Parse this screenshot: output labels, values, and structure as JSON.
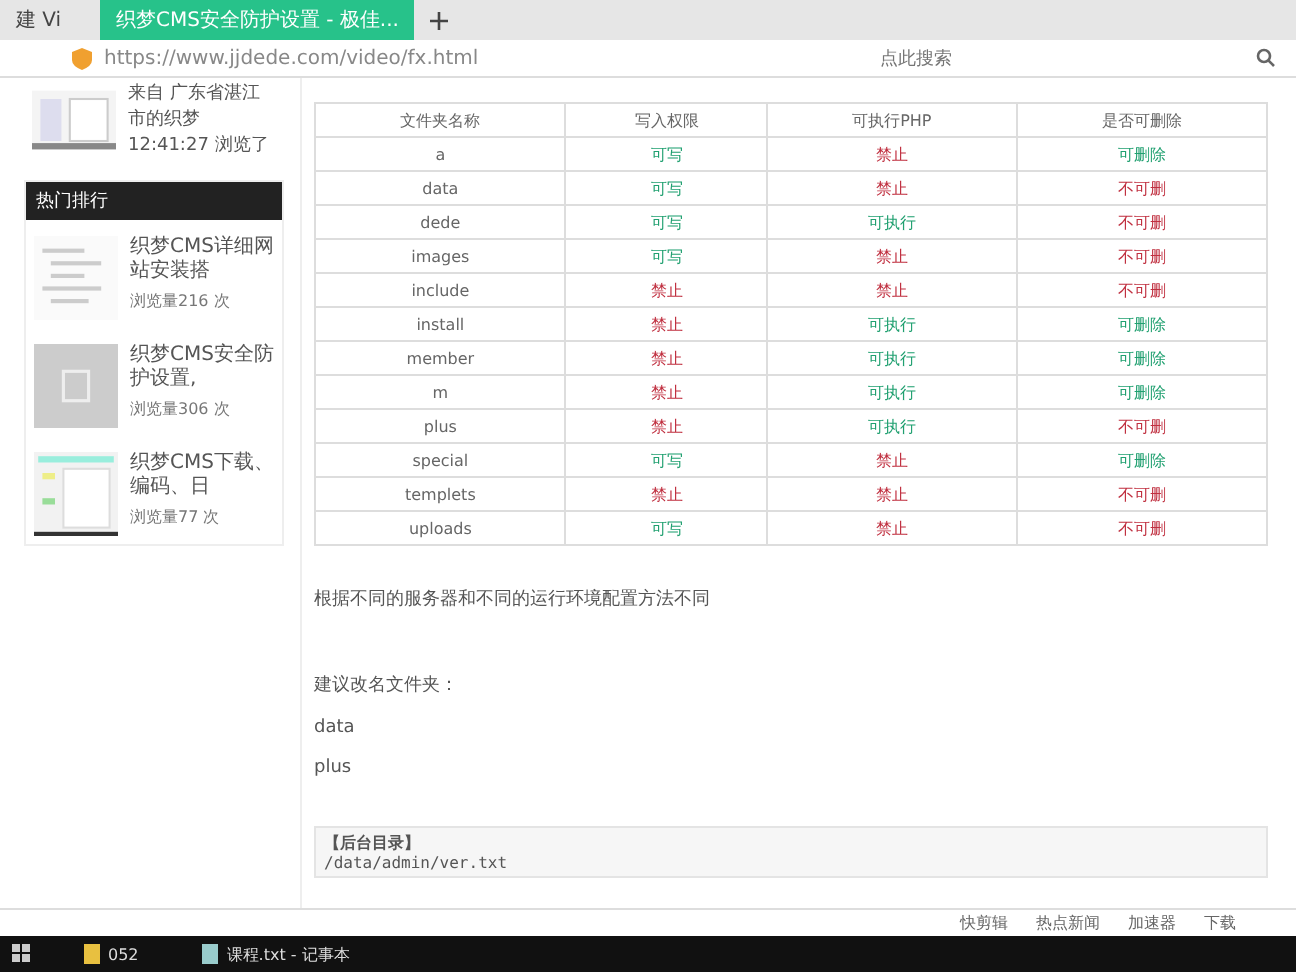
{
  "tabs": [
    {
      "label": "建 Vi",
      "selected": false
    },
    {
      "label": "织梦CMS安全防护设置 - 极佳...",
      "selected": true
    }
  ],
  "address": {
    "url": "https://www.jjdede.com/video/fx.html",
    "search_placeholder": "点此搜索"
  },
  "sidebar": {
    "visit_note": "来自 广东省湛江市的织梦 12:41:27 浏览了",
    "heading": "热门排行",
    "items": [
      {
        "title": "织梦CMS详细网站安装搭",
        "views": "浏览量216 次"
      },
      {
        "title": "织梦CMS安全防护设置,",
        "views": "浏览量306 次"
      },
      {
        "title": "织梦CMS下载、编码、日",
        "views": "浏览量77 次"
      }
    ]
  },
  "table": {
    "columns": [
      "文件夹名称",
      "写入权限",
      "可执行PHP",
      "是否可删除"
    ],
    "rows": [
      [
        {
          "text": "a"
        },
        {
          "text": "可写",
          "ok": true
        },
        {
          "text": "禁止",
          "ok": false
        },
        {
          "text": "可删除",
          "ok": true
        }
      ],
      [
        {
          "text": "data"
        },
        {
          "text": "可写",
          "ok": true
        },
        {
          "text": "禁止",
          "ok": false
        },
        {
          "text": "不可删",
          "ok": false
        }
      ],
      [
        {
          "text": "dede"
        },
        {
          "text": "可写",
          "ok": true
        },
        {
          "text": "可执行",
          "ok": true
        },
        {
          "text": "不可删",
          "ok": false
        }
      ],
      [
        {
          "text": "images"
        },
        {
          "text": "可写",
          "ok": true
        },
        {
          "text": "禁止",
          "ok": false
        },
        {
          "text": "不可删",
          "ok": false
        }
      ],
      [
        {
          "text": "include"
        },
        {
          "text": "禁止",
          "ok": false
        },
        {
          "text": "禁止",
          "ok": false
        },
        {
          "text": "不可删",
          "ok": false
        }
      ],
      [
        {
          "text": "install"
        },
        {
          "text": "禁止",
          "ok": false
        },
        {
          "text": "可执行",
          "ok": true
        },
        {
          "text": "可删除",
          "ok": true
        }
      ],
      [
        {
          "text": "member"
        },
        {
          "text": "禁止",
          "ok": false
        },
        {
          "text": "可执行",
          "ok": true
        },
        {
          "text": "可删除",
          "ok": true
        }
      ],
      [
        {
          "text": "m"
        },
        {
          "text": "禁止",
          "ok": false
        },
        {
          "text": "可执行",
          "ok": true
        },
        {
          "text": "可删除",
          "ok": true
        }
      ],
      [
        {
          "text": "plus"
        },
        {
          "text": "禁止",
          "ok": false
        },
        {
          "text": "可执行",
          "ok": true
        },
        {
          "text": "不可删",
          "ok": false
        }
      ],
      [
        {
          "text": "special"
        },
        {
          "text": "可写",
          "ok": true
        },
        {
          "text": "禁止",
          "ok": false
        },
        {
          "text": "可删除",
          "ok": true
        }
      ],
      [
        {
          "text": "templets"
        },
        {
          "text": "禁止",
          "ok": false
        },
        {
          "text": "禁止",
          "ok": false
        },
        {
          "text": "不可删",
          "ok": false
        }
      ],
      [
        {
          "text": "uploads"
        },
        {
          "text": "可写",
          "ok": true
        },
        {
          "text": "禁止",
          "ok": false
        },
        {
          "text": "不可删",
          "ok": false
        }
      ]
    ]
  },
  "paragraphs": [
    "根据不同的服务器和不同的运行环境配置方法不同",
    "建议改名文件夹：",
    "data",
    "plus"
  ],
  "code": {
    "title": "【后台目录】",
    "line": "/data/admin/ver.txt"
  },
  "status_bar": [
    "快剪辑",
    "热点新闻",
    "加速器",
    "下载"
  ],
  "taskbar": [
    "052",
    "课程.txt - 记事本"
  ]
}
